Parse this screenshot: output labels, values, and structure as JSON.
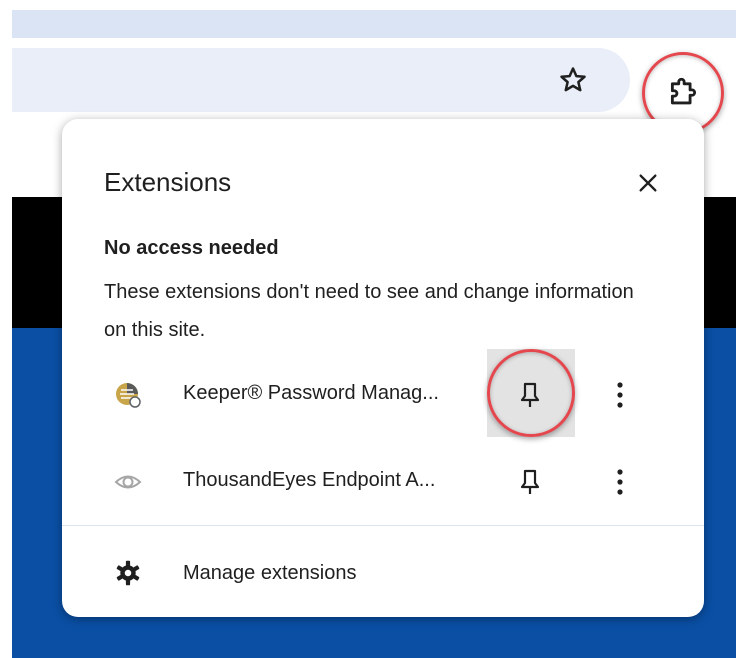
{
  "toolbar": {
    "star_icon": "star-outline-icon",
    "extensions_icon": "puzzle-piece-icon"
  },
  "popup": {
    "title": "Extensions",
    "close_icon": "close-icon",
    "section_heading": "No access needed",
    "section_description": "These extensions don't need to see and change information on this site.",
    "extensions": [
      {
        "name": "Keeper® Password Manag...",
        "icon": "keeper-logo-icon",
        "pin_icon": "pin-icon",
        "menu_icon": "more-vert-icon",
        "pinned": false
      },
      {
        "name": "ThousandEyes Endpoint A...",
        "icon": "eye-icon",
        "pin_icon": "pin-icon",
        "menu_icon": "more-vert-icon",
        "pinned": false
      }
    ],
    "manage_label": "Manage extensions",
    "manage_icon": "gear-icon"
  },
  "colors": {
    "highlight_ring": "#e4474d",
    "page_blue": "#0a4fa4",
    "toolbar_strip": "#dbe4f5",
    "omnibox": "#e9eef8"
  }
}
